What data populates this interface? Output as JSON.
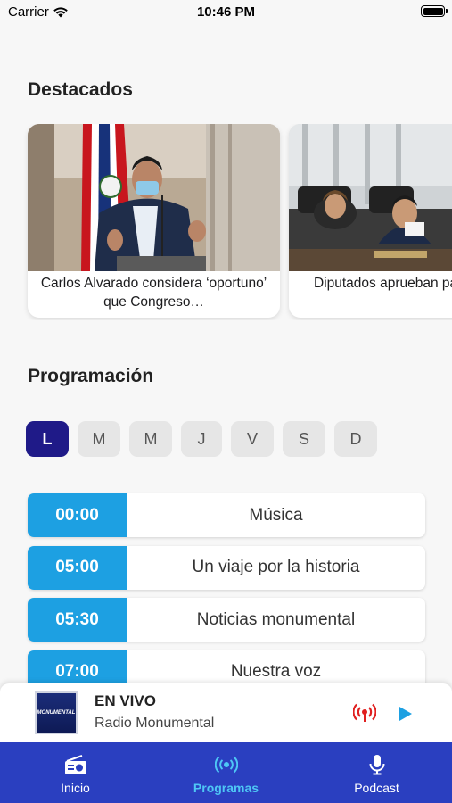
{
  "status_bar": {
    "carrier": "Carrier",
    "time": "10:46 PM"
  },
  "destacados": {
    "title": "Destacados",
    "cards": [
      {
        "caption": "Carlos Alvarado considera ‘oportuno’ que Congreso…"
      },
      {
        "caption": "Diputados aprueban para acortar trám"
      }
    ]
  },
  "programacion": {
    "title": "Programación",
    "days": [
      "L",
      "M",
      "M",
      "J",
      "V",
      "S",
      "D"
    ],
    "selected_day": "L",
    "schedule": [
      {
        "time": "00:00",
        "name": "Música"
      },
      {
        "time": "05:00",
        "name": "Un viaje por la historia"
      },
      {
        "time": "05:30",
        "name": "Noticias monumental"
      },
      {
        "time": "07:00",
        "name": "Nuestra voz"
      }
    ]
  },
  "player": {
    "live_label": "EN VIVO",
    "station": "Radio Monumental",
    "logo_text": "MONUMENTAL"
  },
  "tabs": [
    {
      "label": "Inicio",
      "icon": "radio-icon"
    },
    {
      "label": "Programas",
      "icon": "broadcast-icon"
    },
    {
      "label": "Podcast",
      "icon": "microphone-icon"
    }
  ],
  "colors": {
    "accent": "#1da0e2",
    "selected_day": "#1f1a88",
    "tab_bar": "#2a3fc0",
    "tab_active": "#4ec7f5",
    "live_icon": "#e02020"
  }
}
